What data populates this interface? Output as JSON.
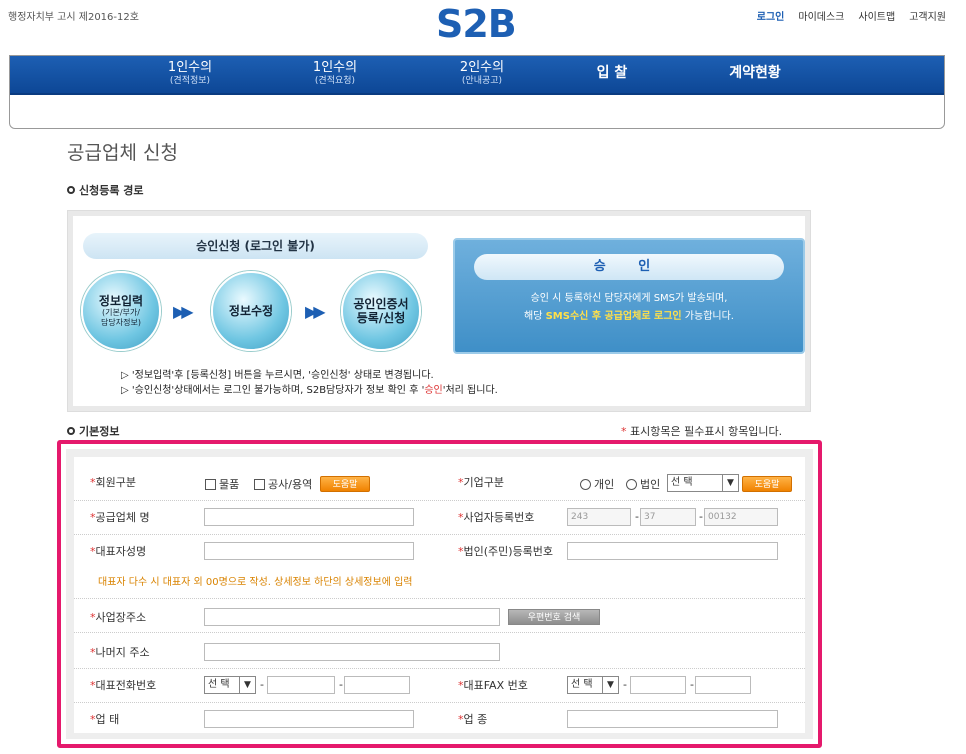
{
  "header": {
    "notice": "행정자치부 고시 제2016-12호",
    "logo": "S2B",
    "links": [
      "로그인",
      "마이데스크",
      "사이트맵",
      "고객지원"
    ]
  },
  "nav": [
    {
      "main": "1인수의",
      "sub": "(견적정보)"
    },
    {
      "main": "1인수의",
      "sub": "(견적요청)"
    },
    {
      "main": "2인수의",
      "sub": "(안내공고)"
    },
    {
      "main": "입 찰",
      "sub": ""
    },
    {
      "main": "계약현황",
      "sub": ""
    }
  ],
  "page_title": "공급업체 신청",
  "section_route": "신청등록 경로",
  "flow": {
    "head": "승인신청 (로그인 불가)",
    "steps": [
      {
        "l1": "정보입력",
        "l2": "(기본/부가/",
        "l3": "담당자정보)"
      },
      {
        "l1": "정보수정",
        "l2": "",
        "l3": ""
      },
      {
        "l1": "공인인증서",
        "l2": "등록/신청",
        "l3": ""
      }
    ],
    "approve_title": "승 인",
    "approve_line1": "승인 시 등록하신 담당자에게 SMS가 발송되며,",
    "approve_line2_a": "해당 ",
    "approve_line2_hl": "SMS수신 후 공급업체로 로그인",
    "approve_line2_b": " 가능합니다.",
    "note1": "▷ '정보입력'후 [등록신청] 버튼을 누르시면, '승인신청' 상태로 변경됩니다.",
    "note2_a": "▷ '승인신청'상태에서는 로그인 불가능하며, S2B담당자가 정보 확인 후 '",
    "note2_red": "승인",
    "note2_b": "'처리 됩니다."
  },
  "section_basic": "기본정보",
  "required_note": "표시항목은 필수표시 항목입니다.",
  "form": {
    "member_type": "회원구분",
    "opt_goods": "물품",
    "opt_work": "공사/용역",
    "help": "도움말",
    "company_type": "기업구분",
    "opt_individual": "개인",
    "opt_corp": "법인",
    "select": "선 택",
    "company_name": "공급업체 명",
    "biz_no": "사업자등록번호",
    "biz_no_1": "243",
    "biz_no_2": "37",
    "biz_no_3": "00132",
    "ceo_name": "대표자성명",
    "corp_no": "법인(주민)등록번호",
    "ceo_note": "대표자 다수 시 대표자 외 00명으로 작성. 상세정보 하단의 상세정보에 입력",
    "address": "사업장주소",
    "zip_search": "우편번호 검색",
    "address_rest": "나머지 주소",
    "phone": "대표전화번호",
    "fax": "대표FAX 번호",
    "biz_type": "업 태",
    "biz_item": "업 종"
  }
}
